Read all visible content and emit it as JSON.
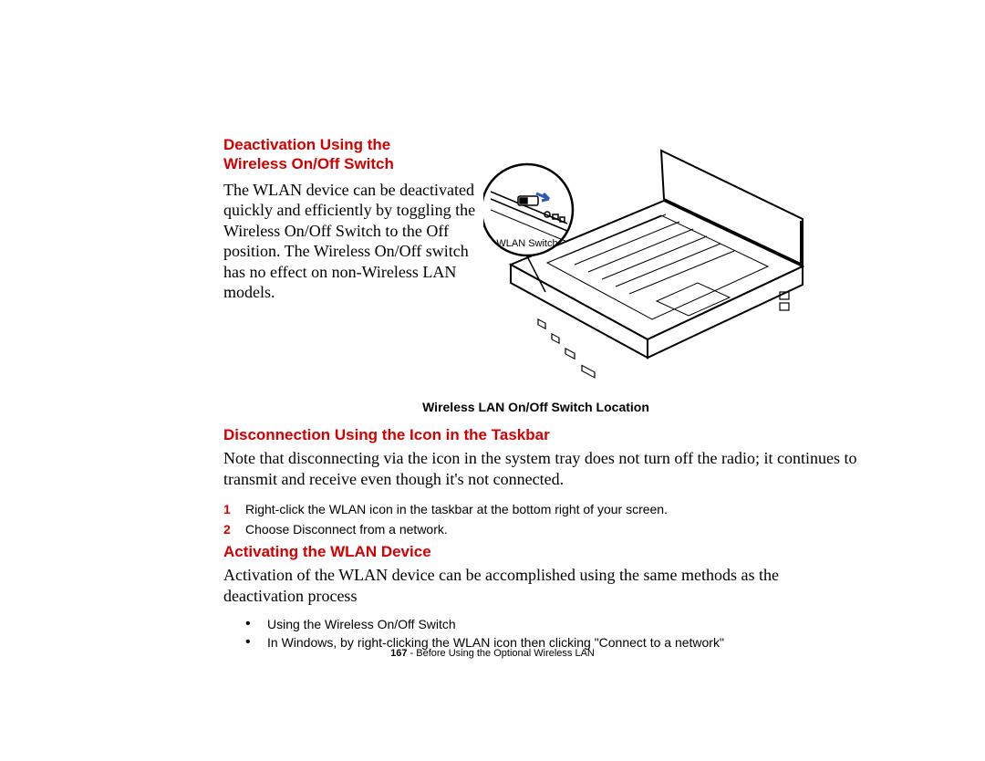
{
  "section1": {
    "heading_line1": "Deactivation Using the",
    "heading_line2": "Wireless On/Off Switch",
    "body": "The WLAN device can be deactivated quickly and efficiently by toggling the Wireless On/Off Switch to the Off position. The Wireless On/Off switch has no effect on non-Wireless LAN models."
  },
  "figure": {
    "label": "WLAN Switch",
    "caption": "Wireless LAN On/Off Switch Location"
  },
  "section2": {
    "heading": "Disconnection Using the Icon in the Taskbar",
    "body": "Note that disconnecting via the icon in the system tray does not turn off the radio; it continues to transmit and receive even though it's not connected.",
    "steps": [
      {
        "n": "1",
        "t": "Right-click the WLAN icon in the taskbar at the bottom right of your screen."
      },
      {
        "n": "2",
        "t": "Choose Disconnect from a network."
      }
    ]
  },
  "section3": {
    "heading": "Activating the WLAN Device",
    "body": "Activation of the WLAN device can be accomplished using the same methods as the deactivation process",
    "bullets": [
      "Using the Wireless On/Off Switch",
      "In Windows, by right-clicking the WLAN icon then clicking \"Connect to a network\""
    ]
  },
  "footer": {
    "page": "167",
    "sep": " - ",
    "title": "Before Using the Optional Wireless LAN"
  }
}
